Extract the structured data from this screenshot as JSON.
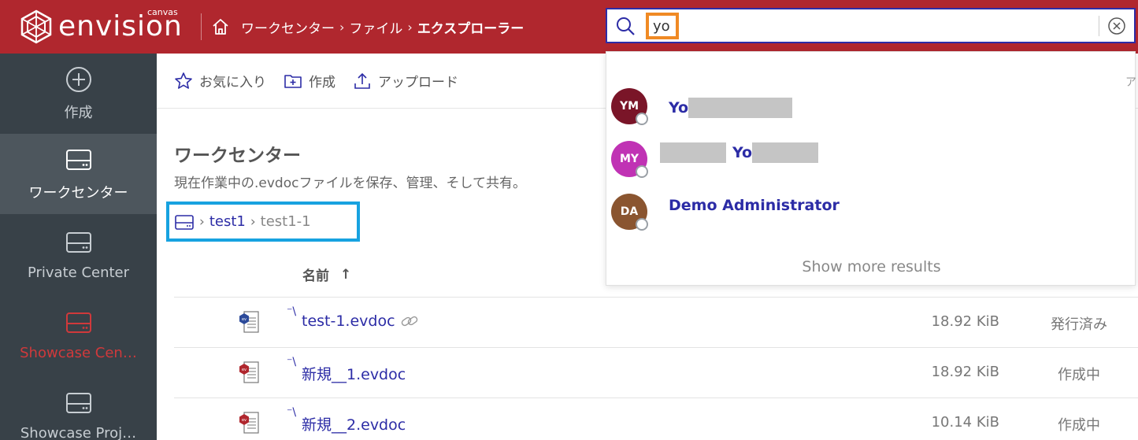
{
  "app": {
    "logo_text": "envision",
    "logo_sub": "canvas"
  },
  "header": {
    "breadcrumbs": [
      "ワークセンター",
      "ファイル",
      "エクスプローラー"
    ],
    "search_value": "yo"
  },
  "sidebar": {
    "items": [
      {
        "label": "作成",
        "icon": "plus-circle-icon",
        "state": "normal"
      },
      {
        "label": "ワークセンター",
        "icon": "drive-icon",
        "state": "active"
      },
      {
        "label": "Private Center",
        "icon": "drive-icon",
        "state": "normal"
      },
      {
        "label": "Showcase Cen…",
        "icon": "drive-icon",
        "state": "red"
      },
      {
        "label": "Showcase Proj…",
        "icon": "drive-icon",
        "state": "normal"
      }
    ]
  },
  "toolbar": {
    "favorites": "お気に入り",
    "create": "作成",
    "upload": "アップロード"
  },
  "page": {
    "title": "ワークセンター",
    "description": "現在作業中の.evdocファイルを保存、管理、そして共有。",
    "path": [
      "test1",
      "test1-1"
    ]
  },
  "table": {
    "name_header": "名前",
    "rows": [
      {
        "name": "test-1.evdoc",
        "size": "18.92 KiB",
        "status": "発行済み",
        "icon_color": "#2c4a9a",
        "linked": true
      },
      {
        "name": "新規__1.evdoc",
        "size": "18.92 KiB",
        "status": "作成中",
        "icon_color": "#b0272e",
        "linked": false
      },
      {
        "name": "新規__2.evdoc",
        "size": "10.14 KiB",
        "status": "作成中",
        "icon_color": "#b0272e",
        "linked": false
      }
    ]
  },
  "search_results": {
    "items": [
      {
        "initials": "YM",
        "name_visible": "Yo",
        "avatar_color": "#7a1528"
      },
      {
        "initials": "MY",
        "name_visible": "Yo",
        "avatar_color": "#c032b4"
      },
      {
        "initials": "DA",
        "name_visible": "Demo Administrator",
        "avatar_color": "#8a5530"
      }
    ],
    "show_more": "Show more results"
  },
  "colors": {
    "header_bg": "#b0272e",
    "sidebar_bg": "#384148",
    "link": "#2c2ca6",
    "path_highlight": "#17a2e0",
    "search_highlight": "#f08a24"
  }
}
